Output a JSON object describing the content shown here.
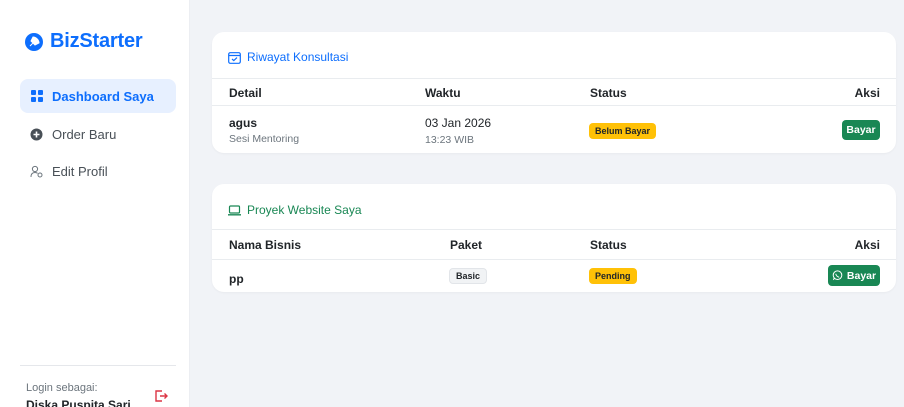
{
  "app": {
    "brand": "BizStarter",
    "colors": {
      "primary": "#0d6efd",
      "success": "#198754",
      "warning": "#ffc107",
      "danger": "#dc3545"
    }
  },
  "sidebar": {
    "items": [
      {
        "label": "Dashboard Saya",
        "icon": "grid-icon",
        "active": true
      },
      {
        "label": "Order Baru",
        "icon": "plus-circle-icon",
        "active": false
      },
      {
        "label": "Edit Profil",
        "icon": "user-gear-icon",
        "active": false
      }
    ],
    "login_label": "Login sebagai:",
    "login_user": "Diska Puspita Sari"
  },
  "consultations": {
    "title": "Riwayat Konsultasi",
    "columns": [
      "Detail",
      "Waktu",
      "Status",
      "Aksi"
    ],
    "rows": [
      {
        "name": "agus",
        "type": "Sesi Mentoring",
        "date": "03 Jan 2026",
        "time": "13:23 WIB",
        "status": "Belum Bayar",
        "action": "Bayar"
      }
    ]
  },
  "projects": {
    "title": "Proyek Website Saya",
    "columns": [
      "Nama Bisnis",
      "Paket",
      "Status",
      "Aksi"
    ],
    "rows": [
      {
        "name": "pp",
        "package": "Basic",
        "status": "Pending",
        "action": "Bayar",
        "action_icon": "whatsapp-icon"
      }
    ]
  }
}
